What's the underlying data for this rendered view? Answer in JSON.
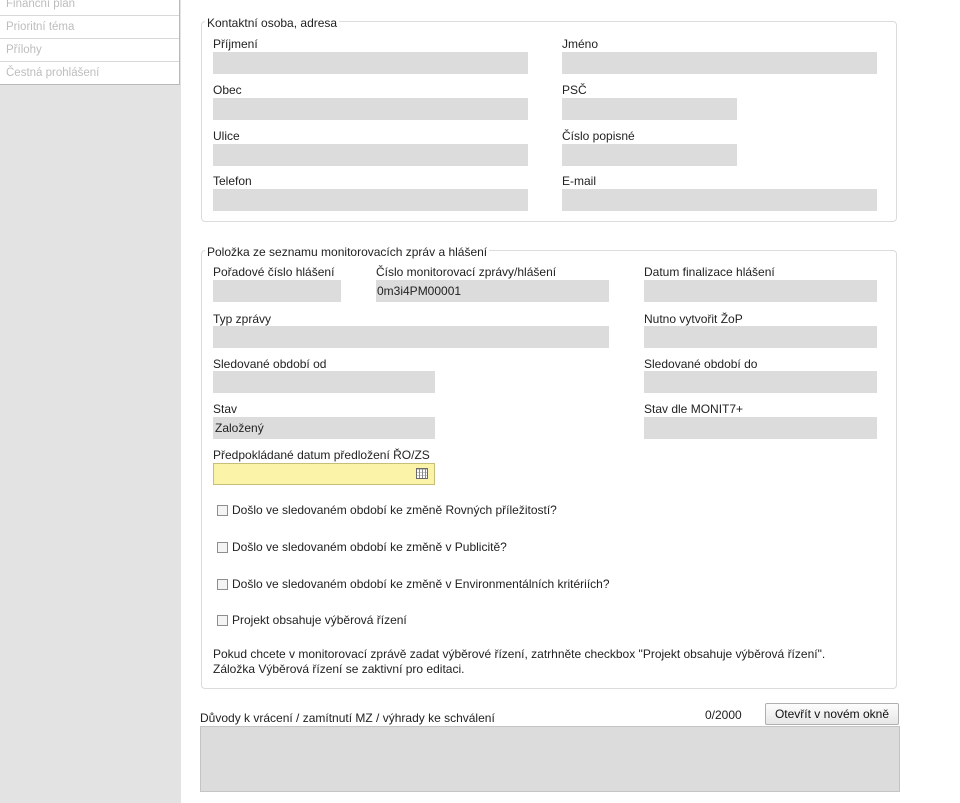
{
  "sidebar": {
    "items": [
      {
        "label": "Finanční plán"
      },
      {
        "label": "Prioritní téma"
      },
      {
        "label": "Přílohy"
      },
      {
        "label": "Čestná prohlášení"
      }
    ]
  },
  "contact": {
    "legend": "Kontaktní osoba, adresa",
    "surname_label": "Příjmení",
    "surname_value": "",
    "firstname_label": "Jméno",
    "firstname_value": "",
    "city_label": "Obec",
    "city_value": "",
    "zip_label": "PSČ",
    "zip_value": "",
    "street_label": "Ulice",
    "street_value": "",
    "house_no_label": "Číslo popisné",
    "house_no_value": "",
    "phone_label": "Telefon",
    "phone_value": "",
    "email_label": "E-mail",
    "email_value": ""
  },
  "report": {
    "legend": "Položka ze seznamu monitorovacích zpráv a hlášení",
    "order_label": "Pořadové číslo hlášení",
    "order_value": "",
    "number_label": "Číslo monitorovací zprávy/hlášení",
    "number_value": "0m3i4PM00001",
    "final_date_label": "Datum finalizace hlášení",
    "final_date_value": "",
    "type_label": "Typ zprávy",
    "type_value": "",
    "zop_label": "Nutno vytvořit ŽoP",
    "zop_value": "",
    "period_from_label": "Sledované období od",
    "period_from_value": "",
    "period_to_label": "Sledované období do",
    "period_to_value": "",
    "state_label": "Stav",
    "state_value": "Založený",
    "monit_state_label": "Stav dle MONIT7+",
    "monit_state_value": "",
    "submit_date_label": "Předpokládané datum předložení ŘO/ZS",
    "submit_date_value": "",
    "checkboxes": [
      {
        "label": "Došlo ve sledovaném období ke změně Rovných příležitostí?",
        "checked": false
      },
      {
        "label": "Došlo ve sledovaném období ke změně v Publicitě?",
        "checked": false
      },
      {
        "label": "Došlo ve sledovaném období ke změně v Environmentálních kritériích?",
        "checked": false
      },
      {
        "label": "Projekt obsahuje výběrová řízení",
        "checked": false
      }
    ],
    "note_line1": "Pokud chcete v monitorovací zprávě zadat výběrové řízení, zatrhněte checkbox \"Projekt obsahuje výběrová řízení\".",
    "note_line2": "Záložka Výběrová řízení se zaktivní pro editaci."
  },
  "reasons": {
    "label": "Důvody k vrácení / zamítnutí MZ / výhrady ke schválení",
    "counter": "0/2000",
    "open_button": "Otevřít v novém okně",
    "value": ""
  },
  "icons": {
    "calendar": "calendar-icon"
  }
}
